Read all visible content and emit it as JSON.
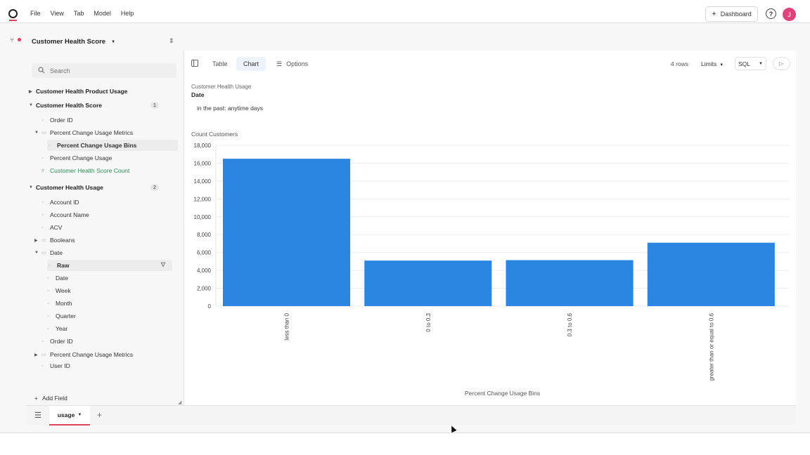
{
  "menubar": {
    "menus": [
      "File",
      "View",
      "Tab",
      "Model",
      "Help"
    ],
    "dashboard_label": "Dashboard",
    "help_label": "?",
    "avatar_initial": "J",
    "accent_color": "#e0415a"
  },
  "sidebar": {
    "model_title": "Customer Health Score",
    "search_placeholder": "Search",
    "add_field_label": "Add Field",
    "rows": [
      {
        "label": "Customer Health Product Usage",
        "type": "group",
        "expanded": false,
        "badge": ""
      },
      {
        "label": "Customer Health Score",
        "type": "group",
        "expanded": true,
        "badge": "1"
      },
      {
        "label": "Order ID",
        "type": "field"
      },
      {
        "label": "Percent Change Usage Metrics",
        "type": "folder",
        "expanded": true
      },
      {
        "label": "Percent Change Usage Bins",
        "type": "field",
        "selected": true
      },
      {
        "label": "Percent Change Usage",
        "type": "field"
      },
      {
        "label": "Customer Health Score Count",
        "type": "measure"
      },
      {
        "label": "Customer Health Usage",
        "type": "group",
        "expanded": true,
        "badge": "2"
      },
      {
        "label": "Account ID",
        "type": "field"
      },
      {
        "label": "Account Name",
        "type": "field"
      },
      {
        "label": "ACV",
        "type": "field"
      },
      {
        "label": "Booleans",
        "type": "folder",
        "expanded": false
      },
      {
        "label": "Date",
        "type": "folder",
        "expanded": true
      },
      {
        "label": "Raw",
        "type": "field",
        "selected": true
      },
      {
        "label": "Date",
        "type": "field"
      },
      {
        "label": "Week",
        "type": "field"
      },
      {
        "label": "Month",
        "type": "field"
      },
      {
        "label": "Quarter",
        "type": "field"
      },
      {
        "label": "Year",
        "type": "field"
      },
      {
        "label": "Order ID",
        "type": "field"
      },
      {
        "label": "Percent Change Usage Metrics",
        "type": "folder",
        "expanded": false
      },
      {
        "label": "User ID",
        "type": "field"
      }
    ]
  },
  "toolbar": {
    "tabs": [
      "Table",
      "Chart",
      "Options"
    ],
    "active_tab": "Chart",
    "rows_count": "4 rows",
    "limits_label": "Limits",
    "sql_label": "SQL",
    "run_icon": "play-icon"
  },
  "filter": {
    "crumb": "Customer Health Usage",
    "field": "Date",
    "value": "in the past: anytime days"
  },
  "chart_data": {
    "type": "bar",
    "categories": [
      "less than 0",
      "0 to 0.3",
      "0.3 to 0.6",
      "greater than or equal to 0.6"
    ],
    "values": [
      16500,
      5100,
      5150,
      7100
    ],
    "title": "",
    "xlabel": "Percent Change Usage Bins",
    "ylabel": "Count Customers",
    "ylim": [
      0,
      18000
    ],
    "yticks": [
      0,
      2000,
      4000,
      6000,
      8000,
      10000,
      12000,
      14000,
      16000,
      18000
    ],
    "ytick_labels": [
      "0",
      "2,000",
      "4,000",
      "6,000",
      "8,000",
      "10,000",
      "12,000",
      "14,000",
      "16,000",
      "18,000"
    ],
    "bar_color": "#2a86e0",
    "grid": true
  },
  "bottombar": {
    "sheet_tab": "usage"
  }
}
